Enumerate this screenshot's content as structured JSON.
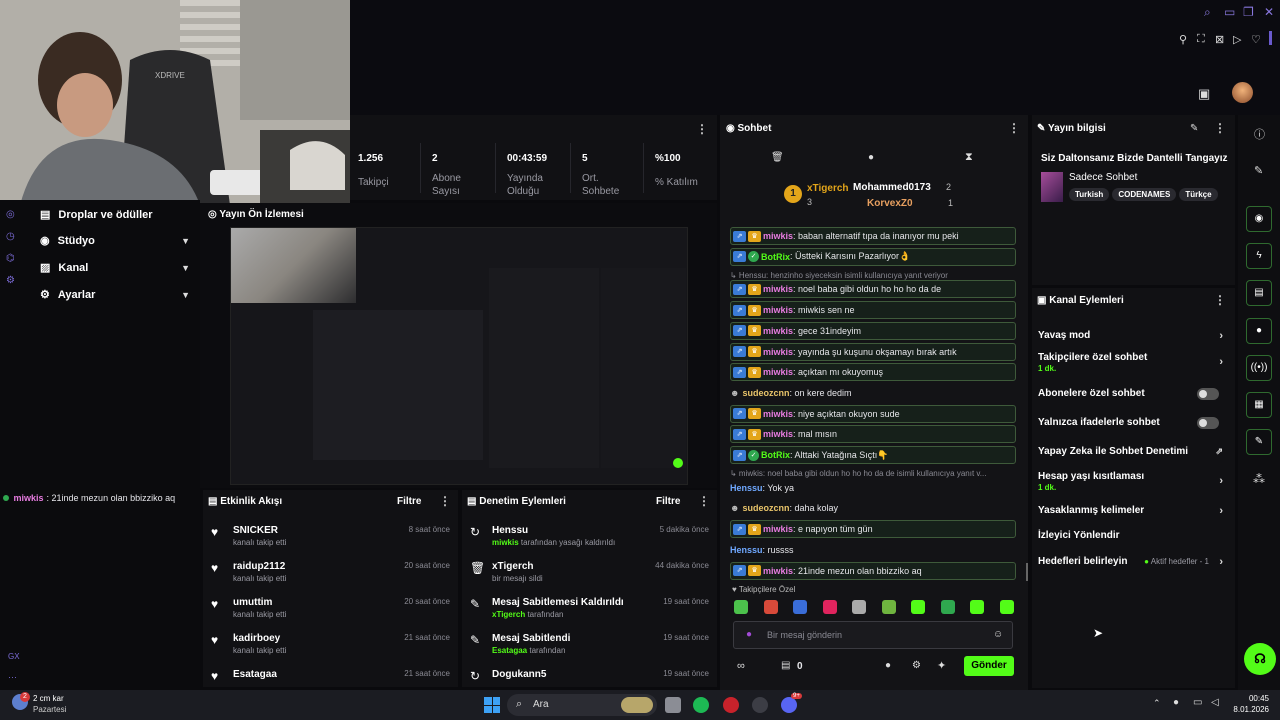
{
  "stats": {
    "items": [
      {
        "value": "1.256",
        "label": "Takipçi"
      },
      {
        "value": "2",
        "label": "Abone Sayısı"
      },
      {
        "value": "00:43:59",
        "label": "Yayında Olduğu"
      },
      {
        "value": "5",
        "label": "Ort. Sohbete"
      },
      {
        "value": "%100",
        "label": "% Katılım"
      }
    ]
  },
  "nav": {
    "items": [
      {
        "label": "Droplar ve ödüller"
      },
      {
        "label": "Stüdyo"
      },
      {
        "label": "Kanal"
      },
      {
        "label": "Ayarlar"
      }
    ]
  },
  "preview": {
    "title": "Yayın Ön İzlemesi"
  },
  "ticker": {
    "nick": "miwkis",
    "text": ": 21inde mezun olan bbizziko aq"
  },
  "activity": {
    "title": "Etkinlik Akışı",
    "filter": "Filtre",
    "items": [
      {
        "name": "SNICKER",
        "sub": "kanalı takip etti",
        "time": "8 saat önce"
      },
      {
        "name": "raidup2112",
        "sub": "kanalı takip etti",
        "time": "20 saat önce"
      },
      {
        "name": "umuttim",
        "sub": "kanalı takip etti",
        "time": "20 saat önce"
      },
      {
        "name": "kadirboey",
        "sub": "kanalı takip etti",
        "time": "21 saat önce"
      },
      {
        "name": "Esatagaa",
        "sub": "",
        "time": "21 saat önce"
      }
    ]
  },
  "moderation": {
    "title": "Denetim Eylemleri",
    "filter": "Filtre",
    "items": [
      {
        "name": "Henssu",
        "actor": "miwkis",
        "sub": "tarafından yasağı kaldırıldı",
        "time": "5 dakika önce"
      },
      {
        "name": "xTigerch",
        "actor": "",
        "sub": "bir mesajı sildi",
        "time": "44 dakika önce"
      },
      {
        "name": "Mesaj Sabitlemesi Kaldırıldı",
        "actor": "xTigerch",
        "sub": "tarafından",
        "time": "19 saat önce"
      },
      {
        "name": "Mesaj Sabitlendi",
        "actor": "Esatagaa",
        "sub": "tarafından",
        "time": "19 saat önce"
      },
      {
        "name": "Dogukann5",
        "actor": "",
        "sub": "",
        "time": "19 saat önce"
      }
    ]
  },
  "chat": {
    "title": "Sohbet",
    "top": [
      {
        "rank": "1",
        "name": "xTigerch",
        "count": "3"
      },
      {
        "name": "Mohammed0173",
        "count": "2"
      },
      {
        "name": "KorvexZ0",
        "count": "1"
      }
    ],
    "messages": [
      {
        "nick": "miwkis",
        "color": "#e77ce0",
        "text": ": baban alternatif tıpa da inanıyor mu peki",
        "hl": true,
        "badges": "bg"
      },
      {
        "nick": "BotRix",
        "color": "#53fc18",
        "text": ": Üstteki Karısını Pazarlıyor👌",
        "hl": true,
        "badges": "v"
      },
      {
        "reply": "↳ Henssu: henzinho siyeceksin isimli kullanıcıya yanıt veriyor"
      },
      {
        "nick": "miwkis",
        "color": "#e77ce0",
        "text": ": noel baba gibi oldun ho ho ho da de",
        "hl": true,
        "badges": "bg"
      },
      {
        "nick": "miwkis",
        "color": "#e77ce0",
        "text": ": miwkis sen ne",
        "hl": true,
        "badges": "bg"
      },
      {
        "nick": "miwkis",
        "color": "#e77ce0",
        "text": ": gece 31indeyim",
        "hl": true,
        "badges": "bg"
      },
      {
        "nick": "miwkis",
        "color": "#e77ce0",
        "text": ": yayında şu kuşunu okşamayı bırak artık",
        "hl": true,
        "badges": "bg"
      },
      {
        "nick": "miwkis",
        "color": "#e77ce0",
        "text": ": açıktan mı okuyomuş",
        "hl": true,
        "badges": "bg"
      },
      {
        "nick": "sudeozcnn",
        "color": "#e8c46a",
        "text": ": on kere dedim",
        "hl": false,
        "badges": "m"
      },
      {
        "nick": "miwkis",
        "color": "#e77ce0",
        "text": ": niye açıktan okuyon sude",
        "hl": true,
        "badges": "bg"
      },
      {
        "nick": "miwkis",
        "color": "#e77ce0",
        "text": ": mal mısın",
        "hl": true,
        "badges": "bg"
      },
      {
        "nick": "BotRix",
        "color": "#53fc18",
        "text": ": Alttaki Yatağına Sıçtı👇",
        "hl": true,
        "badges": "v"
      },
      {
        "reply": "↳ miwkis: noel baba gibi oldun ho ho ho da de isimli kullanıcıya yanıt v..."
      },
      {
        "nick": "Henssu",
        "color": "#6fa8ff",
        "text": ": Yok ya",
        "hl": false,
        "badges": ""
      },
      {
        "nick": "sudeozcnn",
        "color": "#e8c46a",
        "text": ": daha kolay",
        "hl": false,
        "badges": "m"
      },
      {
        "nick": "miwkis",
        "color": "#e77ce0",
        "text": ": e napıyon tüm gün",
        "hl": true,
        "badges": "bg"
      },
      {
        "nick": "Henssu",
        "color": "#6fa8ff",
        "text": ": russss",
        "hl": false,
        "badges": ""
      },
      {
        "nick": "miwkis",
        "color": "#e77ce0",
        "text": ": 21inde mezun olan bbizziko aq",
        "hl": true,
        "badges": "bg"
      }
    ],
    "emote_label": "Takipçilere Özel",
    "input_placeholder": "Bir mesaj gönderin",
    "points": "0",
    "send": "Gönder"
  },
  "info": {
    "title": "Yayın bilgisi",
    "stream_title": "Siz Daltonsanız Bizde Dantelli Tangayız",
    "category": "Sadece Sohbet",
    "tags": [
      "Turkish",
      "CODENAMES",
      "Türkçe"
    ]
  },
  "actions": {
    "title": "Kanal Eylemleri",
    "items": [
      {
        "label": "Yavaş mod",
        "sub": "",
        "ctrl": "chev"
      },
      {
        "label": "Takipçilere özel sohbet",
        "sub": "1 dk.",
        "ctrl": "chev"
      },
      {
        "label": "Abonelere özel sohbet",
        "sub": "",
        "ctrl": "toggle"
      },
      {
        "label": "Yalnızca ifadelerle sohbet",
        "sub": "",
        "ctrl": "toggle"
      },
      {
        "label": "Yapay Zeka ile Sohbet Denetimi",
        "sub": "",
        "ctrl": "ext"
      },
      {
        "label": "Hesap yaşı kısıtlaması",
        "sub": "1 dk.",
        "ctrl": "chev"
      },
      {
        "label": "Yasaklanmış kelimeler",
        "sub": "",
        "ctrl": "chev"
      },
      {
        "label": "İzleyici Yönlendir",
        "sub": "",
        "ctrl": ""
      },
      {
        "label": "Hedefleri belirleyin",
        "sub": "",
        "ctrl": "goal",
        "goal": "Aktif hedefler - 1"
      }
    ]
  },
  "taskbar": {
    "weather_temp": "2 cm kar",
    "weather_day": "Pazartesi",
    "weather_badge": "2",
    "search": "Ara",
    "time": "00:45",
    "date": "8.01.2026",
    "discord_badge": "9+"
  },
  "colors": {
    "accent": "#53fc18",
    "chat_bg": "#131316",
    "panel_bg": "#111114"
  }
}
